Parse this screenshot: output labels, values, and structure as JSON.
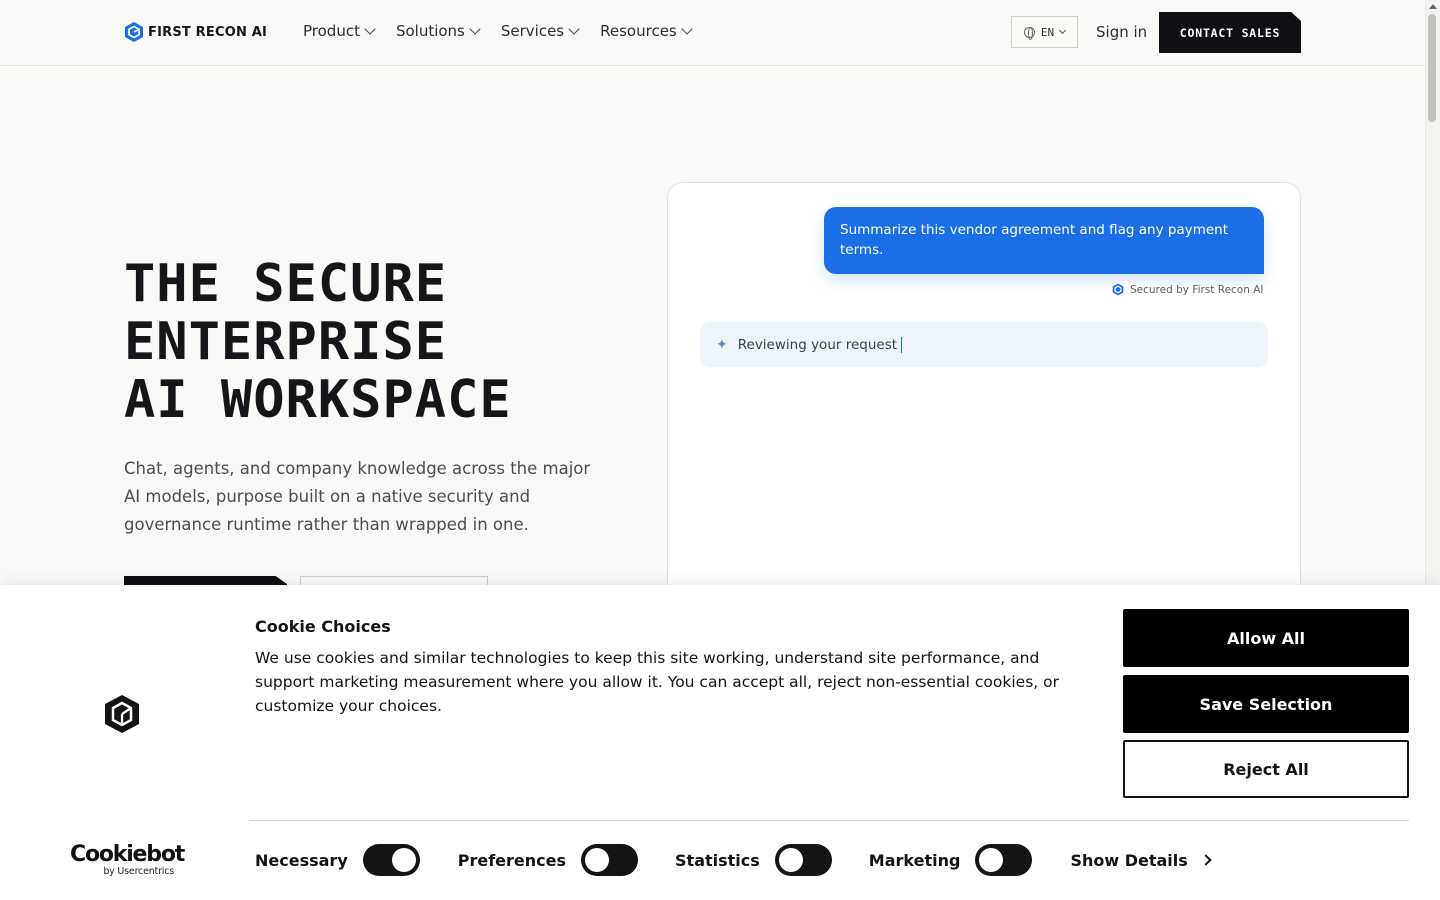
{
  "header": {
    "logo_text": "FIRST RECON AI",
    "nav": [
      {
        "label": "Product"
      },
      {
        "label": "Solutions"
      },
      {
        "label": "Services"
      },
      {
        "label": "Resources"
      }
    ],
    "language": "EN",
    "sign_in": "Sign in",
    "contact_sales": "CONTACT SALES"
  },
  "hero": {
    "title_lines": [
      "THE SECURE",
      "ENTERPRISE",
      "AI WORKSPACE"
    ],
    "subtitle": "Chat, agents, and company knowledge across the major AI models, purpose built on a native security and governance runtime rather than wrapped in one."
  },
  "chat": {
    "user_message": "Summarize this vendor agreement and flag any payment terms.",
    "secured_label": "Secured by First Recon AI",
    "status_text": "Reviewing your request"
  },
  "cookie": {
    "title": "Cookie Choices",
    "body": "We use cookies and similar technologies to keep this site working, understand site performance, and support marketing measurement where you allow it. You can accept all, reject non-essential cookies, or customize your choices.",
    "allow_all": "Allow All",
    "save_selection": "Save Selection",
    "reject_all": "Reject All",
    "toggles": [
      {
        "label": "Necessary",
        "state": "on"
      },
      {
        "label": "Preferences",
        "state": "off"
      },
      {
        "label": "Statistics",
        "state": "off"
      },
      {
        "label": "Marketing",
        "state": "off"
      }
    ],
    "show_details": "Show Details",
    "brand": "Cookiebot",
    "brand_sub": "by Usercentrics"
  },
  "colors": {
    "accent_blue": "#1b6fe6",
    "dark": "#0e1014",
    "background": "#f9f9f7"
  }
}
